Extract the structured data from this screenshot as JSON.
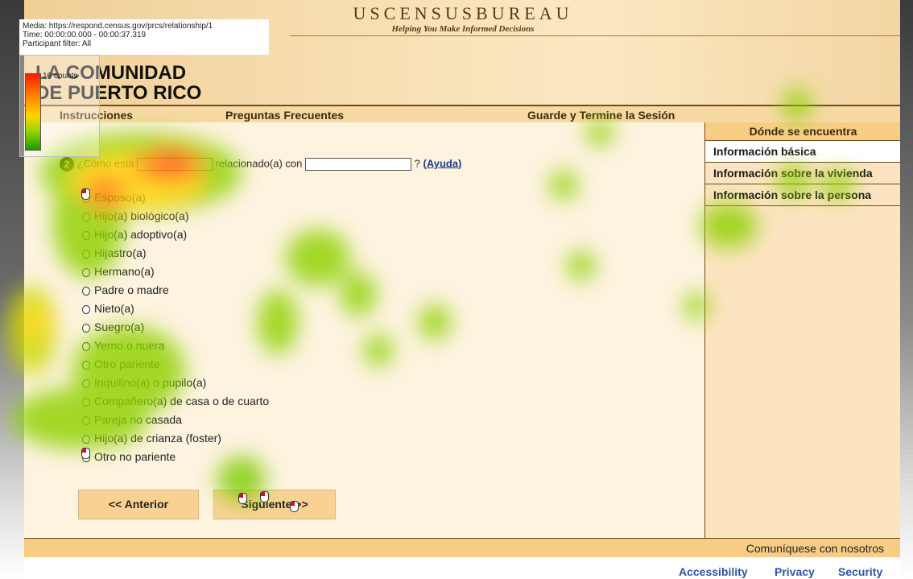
{
  "recording": {
    "media": "Media: https://respond.census.gov/prcs/relationship/1",
    "time": "Time: 00:00:00.000 - 00:00:37.319",
    "participant": "Participant filter: All",
    "legend_label": "16 counts"
  },
  "header": {
    "bureau": "USCENSUSBUREAU",
    "tagline": "Helping You Make Informed Decisions",
    "community_line1": "LA COMUNIDAD",
    "community_line2": "DE PUERTO RICO"
  },
  "nav": {
    "instrucciones": "Instrucciones",
    "preguntas": "Preguntas Frecuentes",
    "guarde": "Guarde y Termine la Sesión"
  },
  "sidebar": {
    "title": "Dónde se encuentra",
    "items": [
      {
        "label": "Información básica"
      },
      {
        "label": "Información sobre la vivienda"
      },
      {
        "label": "Información sobre la persona"
      }
    ]
  },
  "question": {
    "number": "2",
    "part1": "¿Cómo está",
    "part2": "relacionado(a) con",
    "part3": "?",
    "help": "(Ayuda)"
  },
  "options": [
    "Esposo(a)",
    "Hijo(a) biológico(a)",
    "Hijo(a) adoptivo(a)",
    "Hijastro(a)",
    "Hermano(a)",
    "Padre o madre",
    "Nieto(a)",
    "Suegro(a)",
    "Yerno o nuera",
    "Otro pariente",
    "Inquilino(a) o pupilo(a)",
    "Compañero(a) de casa o de cuarto",
    "Pareja no casada",
    "Hijo(a) de crianza (foster)",
    "Otro no pariente"
  ],
  "buttons": {
    "prev": "<<  Anterior",
    "next": "Siguiente  >>"
  },
  "footer": {
    "contact": "Comuníquese con nosotros",
    "accessibility": "Accessibility",
    "privacy": "Privacy",
    "security": "Security"
  },
  "colors": {
    "banner": "#f7deb0",
    "nav": "#f7d9a4",
    "page": "#fdf3df",
    "sidebar": "#fbe4bf",
    "link": "#2a55a6"
  }
}
